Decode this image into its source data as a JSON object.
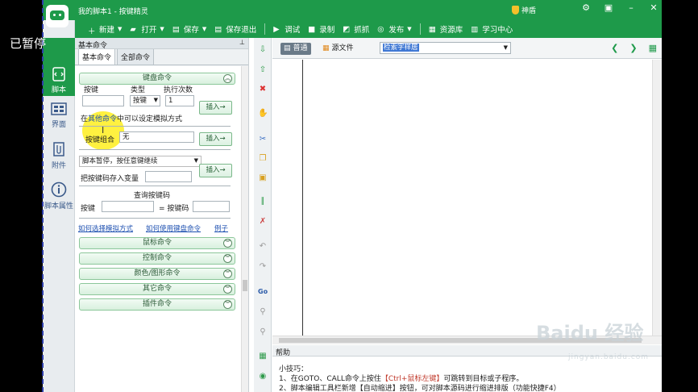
{
  "overlay": {
    "paused_label": "已暂停"
  },
  "window": {
    "title": "我的脚本1 - 按键精灵",
    "vip_label": "神盾",
    "accent_color": "#1e9a4a",
    "controls": [
      "gear",
      "restore-down",
      "minimize",
      "close"
    ]
  },
  "toolbar": {
    "items": [
      {
        "label": "新建",
        "icon": "plus-icon",
        "dropdown": true
      },
      {
        "label": "打开",
        "icon": "folder-icon",
        "dropdown": true
      },
      {
        "label": "保存",
        "icon": "save-icon",
        "dropdown": true
      },
      {
        "label": "保存退出",
        "icon": "save-exit-icon"
      },
      {
        "label": "调试",
        "icon": "play-icon"
      },
      {
        "label": "录制",
        "icon": "camera-icon"
      },
      {
        "label": "抓抓",
        "icon": "grab-icon"
      },
      {
        "label": "发布",
        "icon": "publish-icon",
        "dropdown": true
      },
      {
        "label": "资源库",
        "icon": "resource-icon"
      },
      {
        "label": "学习中心",
        "icon": "learn-icon"
      }
    ]
  },
  "leftnav": {
    "items": [
      {
        "label": "脚本",
        "icon": "script-icon",
        "active": true
      },
      {
        "label": "界面",
        "icon": "ui-icon"
      },
      {
        "label": "附件",
        "icon": "attachment-icon"
      },
      {
        "label": "脚本属性",
        "icon": "info-icon"
      }
    ]
  },
  "panel": {
    "title": "基本命令",
    "tabs": [
      "基本命令",
      "全部命令"
    ],
    "keyboard": {
      "header": "键盘命令",
      "col_key": "按键",
      "col_type": "类型",
      "col_count": "执行次数",
      "type_value": "按键",
      "count_value": "1",
      "insert": "插入→",
      "note_prefix": "在",
      "note_link": "其他命令",
      "note_suffix": "中可以设定模拟方式",
      "combo_label": "按键组合",
      "combo_value": "无",
      "pause_value": "脚本暂停，按任意键继续",
      "save_label": "把按键码存入变量",
      "query_title": "查询按键码",
      "query_key": "按键",
      "query_code": "= 按键码"
    },
    "links": [
      "如何选择模拟方式",
      "如何使用键盘命令",
      "例子"
    ],
    "sections": [
      "鼠标命令",
      "控制命令",
      "颜色/图形命令",
      "其它命令",
      "插件命令"
    ]
  },
  "editor": {
    "tab_normal": "普通",
    "tab_source": "源文件",
    "select_value": "检索字样居",
    "help_title": "帮助",
    "help_tips_title": "小技巧：",
    "help_line1_prefix": "1、在GOTO、CALL命令上按住",
    "help_line1_key": "【Ctrl+鼠标左键】",
    "help_line1_suffix": "可跳转到目标或子程序。",
    "help_line2": "2、脚本编辑工具栏新增【自动缩进】按钮，可对脚本源码进行缩进排版（功能快捷F4）"
  },
  "watermark": {
    "main": "Baidu 经验",
    "sub": "jingyan.baidu.com"
  }
}
